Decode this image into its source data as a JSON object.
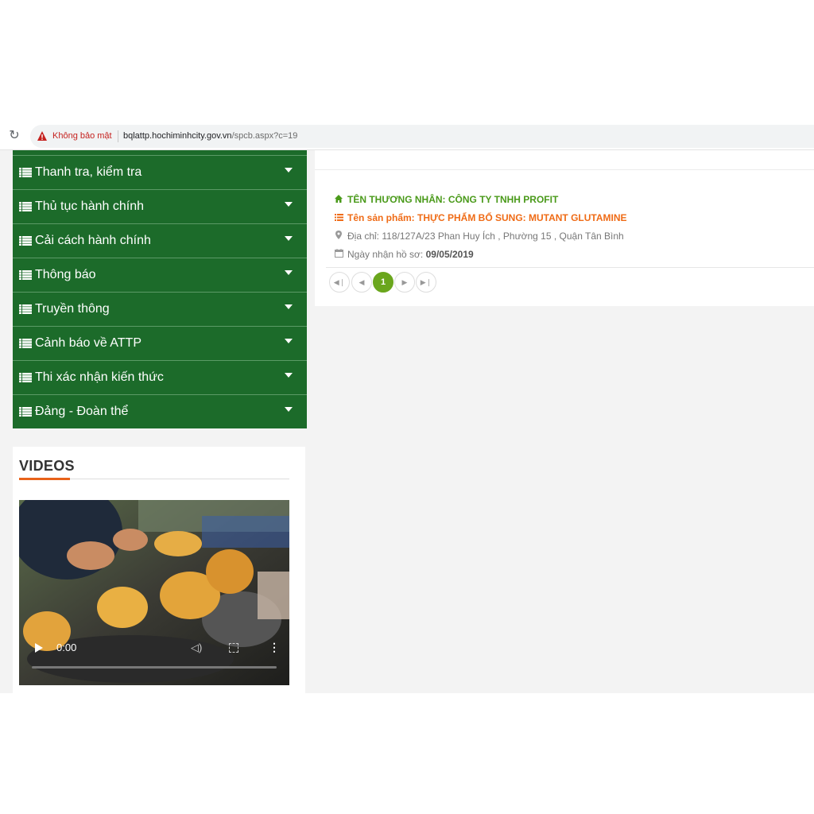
{
  "browser": {
    "security_label": "Không bảo mật",
    "url_host": "bqlattp.hochiminhcity.gov.vn",
    "url_rest": "/spcb.aspx?c=19"
  },
  "menu": {
    "items": [
      {
        "label": "Thanh tra, kiểm tra"
      },
      {
        "label": "Thủ tục hành chính"
      },
      {
        "label": "Cải cách hành chính"
      },
      {
        "label": "Thông báo"
      },
      {
        "label": "Truyền thông"
      },
      {
        "label": "Cảnh báo về ATTP"
      },
      {
        "label": "Thi xác nhận kiến thức"
      },
      {
        "label": "Đảng - Đoàn thể"
      }
    ]
  },
  "videos": {
    "title": "VIDEOS",
    "player": {
      "time": "0:00"
    }
  },
  "record": {
    "merchant_label": "TÊN THƯƠNG NHÂN:",
    "merchant_value": "CÔNG TY TNHH PROFIT",
    "product_label": "Tên sản phẩm:",
    "product_value": "THỰC PHẨM BỔ SUNG: MUTANT GLUTAMINE",
    "address_label": "Địa chỉ:",
    "address_value": "118/127A/23 Phan Huy Ích , Phường 15 , Quận Tân Bình",
    "date_label": "Ngày nhận hồ sơ:",
    "date_value": "09/05/2019"
  },
  "pagination": {
    "current_page": "1"
  },
  "colors": {
    "menu_green": "#1c6b2a",
    "merchant_green": "#4a9a1a",
    "product_orange": "#ef6b16",
    "pager_active": "#6aa61d",
    "accent_orange": "#e8621a"
  }
}
